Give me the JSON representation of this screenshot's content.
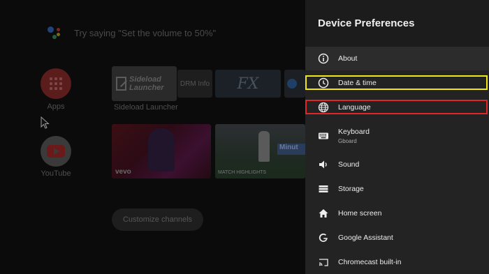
{
  "home": {
    "assistant_hint": "Try saying \"Set the volume to 50%\"",
    "apps_label": "Apps",
    "youtube_label": "YouTube",
    "tiles": {
      "sideload_title": "Sideload Launcher",
      "drm_label": "DRM Info",
      "fx_label": "FX",
      "row_label": "Sideload Launcher",
      "vevo_mark": "vevo",
      "match_text": "MATCH HIGHLIGHTS",
      "match_side": "Minut"
    },
    "customize_label": "Customize channels"
  },
  "panel": {
    "title": "Device Preferences",
    "items": [
      {
        "label": "About",
        "icon": "info-icon"
      },
      {
        "label": "Date & time",
        "icon": "clock-icon"
      },
      {
        "label": "Language",
        "icon": "globe-icon"
      },
      {
        "label": "Keyboard",
        "sub": "Gboard",
        "icon": "keyboard-icon"
      },
      {
        "label": "Sound",
        "icon": "speaker-icon"
      },
      {
        "label": "Storage",
        "icon": "storage-icon"
      },
      {
        "label": "Home screen",
        "icon": "home-icon"
      },
      {
        "label": "Google Assistant",
        "icon": "google-icon"
      },
      {
        "label": "Chromecast built-in",
        "icon": "cast-icon"
      }
    ]
  },
  "colors": {
    "highlight_yellow": "#f1e617",
    "highlight_red": "#e22626",
    "panel_bg": "#232323"
  }
}
